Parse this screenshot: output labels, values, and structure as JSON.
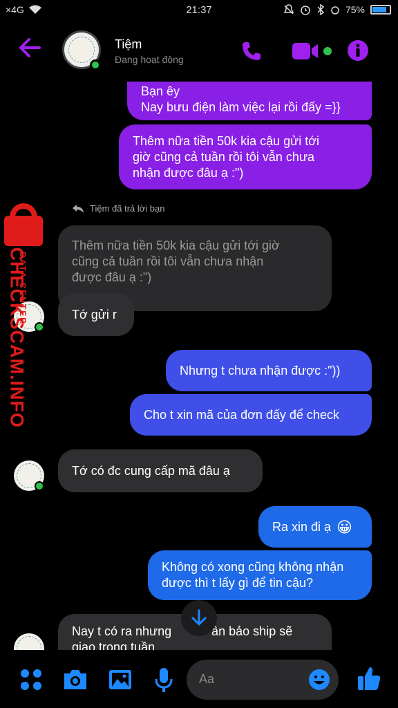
{
  "status_bar": {
    "left": "×4G",
    "time": "21:37",
    "battery": "75%",
    "battery_level": 0.75
  },
  "header": {
    "back_icon": "arrow-left-icon",
    "name": "Tiệm",
    "status": "Đang hoạt động",
    "accent": "#a020f0",
    "icons": [
      "phone-icon",
      "video-icon",
      "info-icon"
    ]
  },
  "messages": {
    "m1": {
      "lines": [
        "Bạn êy",
        "Nay bưu điện làm việc lại rồi đấy =}}"
      ]
    },
    "m2": {
      "lines": [
        "Thêm nữa tiền 50k kia cậu gửi tới",
        "giờ cũng cả tuần rồi tôi vẫn chưa",
        "nhận được đâu ạ :\")"
      ]
    },
    "reply_note": "Tiệm đã trả lời bạn",
    "quoted": {
      "lines": [
        "Thêm nữa tiền 50k kia cậu gửi tới giờ",
        "cũng cả tuần rồi tôi vẫn chưa nhận",
        "được đâu ạ :\")"
      ]
    },
    "m3": "Tớ gửi r",
    "m4": "Nhưng t chưa nhận được :\"))",
    "m5": "Cho t xin mã của đơn đấy để check",
    "m6": "Tớ có đc cung cấp mã đâu ạ",
    "m7": "Ra xin đi ạ",
    "m7_emoji": "😀",
    "m8": {
      "lines": [
        "Không có xong cũng không nhận",
        "được thì t lấy gì để tin cậu?"
      ]
    },
    "m9": {
      "lines": [
        "Nay t có ra nhưng",
        "ân bảo ship sẽ",
        "giao trong tuần"
      ]
    }
  },
  "watermark": {
    "main": "CHECKSCAM.INFO",
    "sub": "DATA CENTER"
  },
  "composer": {
    "placeholder": "Aa",
    "icons": [
      "menu-dots-icon",
      "camera-icon",
      "gallery-icon",
      "microphone-icon",
      "emoji-icon",
      "thumbs-up-icon"
    ],
    "accent": "#1e88ff"
  },
  "colors": {
    "outgoing_purple": "#8a1fe6",
    "outgoing_blue": "#3f4fe8",
    "incoming": "#2f2f31",
    "online": "#31c24d"
  }
}
